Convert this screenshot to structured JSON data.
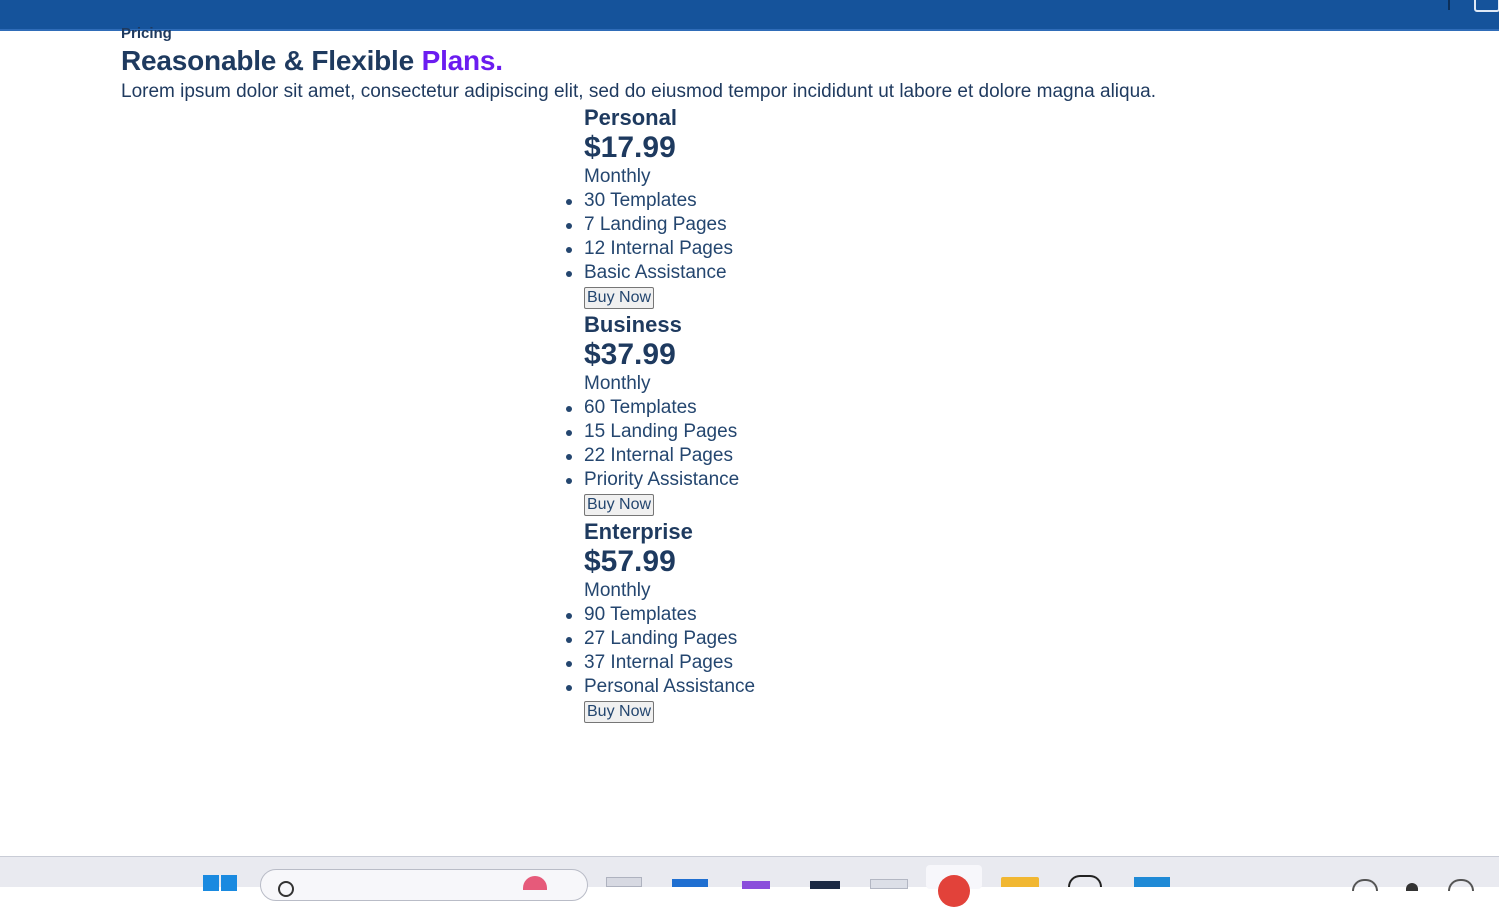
{
  "section": {
    "eyebrow": "Pricing",
    "headline_main": "Reasonable & Flexible ",
    "headline_accent": "Plans.",
    "description": "Lorem ipsum dolor sit amet, consectetur adipiscing elit, sed do eiusmod tempor incididunt ut labore et dolore magna aliqua."
  },
  "plans": [
    {
      "name": "Personal",
      "price": "$17.99",
      "period": "Monthly",
      "features": [
        "30 Templates",
        "7 Landing Pages",
        "12 Internal Pages",
        "Basic Assistance"
      ],
      "button": "Buy Now"
    },
    {
      "name": "Business",
      "price": "$37.99",
      "period": "Monthly",
      "features": [
        "60 Templates",
        "15 Landing Pages",
        "22 Internal Pages",
        "Priority Assistance"
      ],
      "button": "Buy Now"
    },
    {
      "name": "Enterprise",
      "price": "$57.99",
      "period": "Monthly",
      "features": [
        "90 Templates",
        "27 Landing Pages",
        "37 Internal Pages",
        "Personal Assistance"
      ],
      "button": "Buy Now"
    }
  ],
  "colors": {
    "header_bar": "#15539b",
    "heading_text": "#1e3a5f",
    "accent": "#6b1cf0",
    "taskbar": "#e9eaf0"
  },
  "taskbar": {
    "icons": [
      "windows-start-icon",
      "search-icon",
      "file-explorer-icon",
      "chrome-icon",
      "vscode-icon",
      "terminal-icon",
      "chatgpt-icon"
    ]
  }
}
